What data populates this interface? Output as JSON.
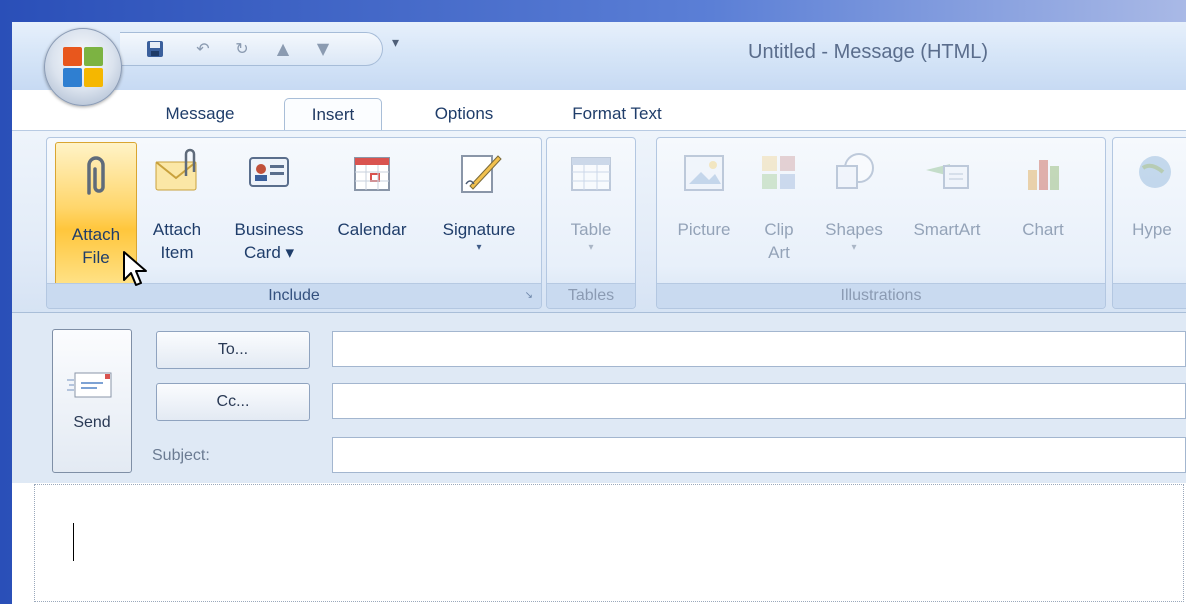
{
  "window": {
    "title": "Untitled - Message (HTML)"
  },
  "quick_access": {
    "customize_glyph": "▾"
  },
  "tabs": [
    {
      "label": "Message",
      "active": false
    },
    {
      "label": "Insert",
      "active": true
    },
    {
      "label": "Options",
      "active": false
    },
    {
      "label": "Format Text",
      "active": false
    }
  ],
  "ribbon": {
    "include": {
      "label": "Include",
      "buttons": {
        "attach_file": {
          "line1": "Attach",
          "line2": "File"
        },
        "attach_item": {
          "line1": "Attach",
          "line2": "Item"
        },
        "business_card": {
          "line1": "Business",
          "line2": "Card ▾"
        },
        "calendar": {
          "line1": "Calendar"
        },
        "signature": {
          "line1": "Signature",
          "line2": "▾"
        }
      }
    },
    "tables": {
      "label": "Tables",
      "table": {
        "line1": "Table",
        "line2": "▾"
      }
    },
    "illustrations": {
      "label": "Illustrations",
      "picture": {
        "line1": "Picture"
      },
      "clip_art": {
        "line1": "Clip",
        "line2": "Art"
      },
      "shapes": {
        "line1": "Shapes",
        "line2": "▾"
      },
      "smartart": {
        "line1": "SmartArt"
      },
      "chart": {
        "line1": "Chart"
      }
    },
    "links": {
      "hyperlink": {
        "line1": "Hype"
      }
    }
  },
  "message": {
    "send_label": "Send",
    "to_label": "To...",
    "cc_label": "Cc...",
    "subject_label": "Subject:",
    "to_value": "",
    "cc_value": "",
    "subject_value": "",
    "body_value": ""
  },
  "colors": {
    "accent": "#ffc63c",
    "ribbon_text": "#1f3d6a",
    "disabled_text": "#94a3b8"
  }
}
